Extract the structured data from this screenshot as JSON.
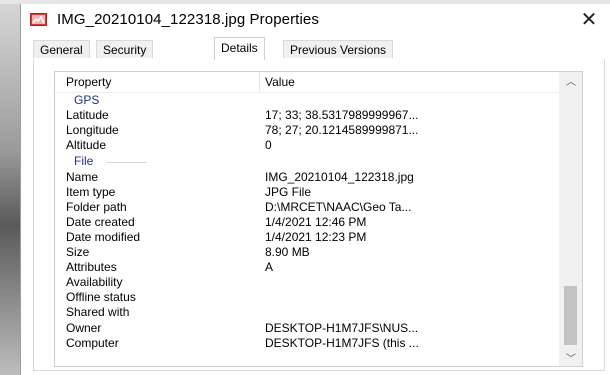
{
  "window": {
    "title": "IMG_20210104_122318.jpg Properties",
    "close_glyph": "✕"
  },
  "tabs": [
    {
      "label": "General",
      "active": false
    },
    {
      "label": "Security",
      "active": false
    },
    {
      "label": "Details",
      "active": true
    },
    {
      "label": "Previous Versions",
      "active": false
    }
  ],
  "details": {
    "columns": {
      "property": "Property",
      "value": "Value"
    },
    "gps_group": "GPS",
    "gps_rows": [
      {
        "property": "Latitude",
        "value": "17; 33; 38.5317989999967..."
      },
      {
        "property": "Longitude",
        "value": "78; 27; 20.1214589999871..."
      },
      {
        "property": "Altitude",
        "value": "0"
      }
    ],
    "file_group": "File",
    "file_rows": [
      {
        "property": "Name",
        "value": "IMG_20210104_122318.jpg"
      },
      {
        "property": "Item type",
        "value": "JPG File"
      },
      {
        "property": "Folder path",
        "value": "D:\\MRCET\\NAAC\\Geo Ta..."
      },
      {
        "property": "Date created",
        "value": "1/4/2021 12:46 PM"
      },
      {
        "property": "Date modified",
        "value": "1/4/2021 12:23 PM"
      },
      {
        "property": "Size",
        "value": "8.90 MB"
      },
      {
        "property": "Attributes",
        "value": "A"
      },
      {
        "property": "Availability",
        "value": ""
      },
      {
        "property": "Offline status",
        "value": ""
      },
      {
        "property": "Shared with",
        "value": ""
      },
      {
        "property": "Owner",
        "value": "DESKTOP-H1M7JFS\\NUS..."
      },
      {
        "property": "Computer",
        "value": "DESKTOP-H1M7JFS (this ..."
      }
    ]
  },
  "scrollbar": {
    "up_glyph": "︿",
    "down_glyph": "﹀"
  },
  "icons": {
    "title_icon": "image-file-icon",
    "title_icon_color": "#d83a3a"
  }
}
